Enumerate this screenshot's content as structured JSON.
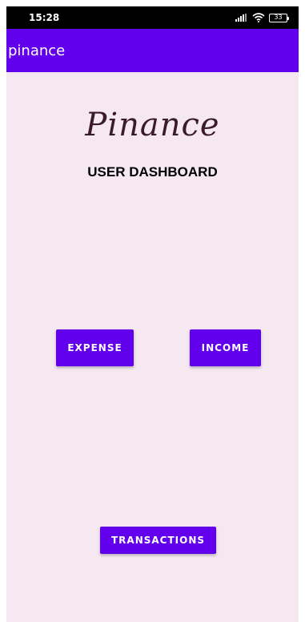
{
  "status_bar": {
    "time": "15:28",
    "battery": "33",
    "icons": [
      "signal-icon",
      "wifi-icon",
      "battery-icon"
    ]
  },
  "app_bar": {
    "title": "pinance"
  },
  "main": {
    "logo": "Pinance",
    "heading": "USER DASHBOARD",
    "buttons": {
      "expense": "EXPENSE",
      "income": "INCOME",
      "transactions": "TRANSACTIONS"
    }
  },
  "colors": {
    "primary": "#6200ee",
    "background": "#f5e8f0",
    "status_bar": "#000000",
    "logo": "#3b1a2c"
  }
}
